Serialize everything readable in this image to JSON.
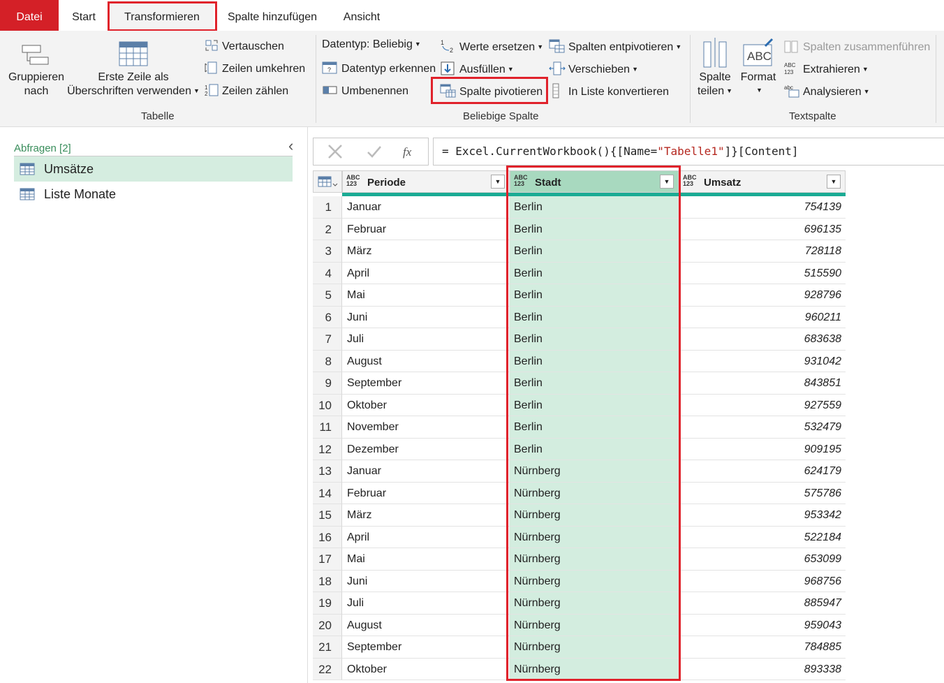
{
  "tabs": {
    "datei": "Datei",
    "start": "Start",
    "transformieren": "Transformieren",
    "spalte_hinzufuegen": "Spalte hinzufügen",
    "ansicht": "Ansicht"
  },
  "ribbon": {
    "tabelle": {
      "gruppieren_l1": "Gruppieren",
      "gruppieren_l2": "nach",
      "erste_zeile_l1": "Erste Zeile als",
      "erste_zeile_l2": "Überschriften verwenden",
      "vertauschen": "Vertauschen",
      "zeilen_umkehren": "Zeilen umkehren",
      "zeilen_zaehlen": "Zeilen zählen",
      "group_label": "Tabelle"
    },
    "beliebige_spalte": {
      "datentyp": "Datentyp: Beliebig",
      "datentyp_erkennen": "Datentyp erkennen",
      "umbenennen": "Umbenennen",
      "werte_ersetzen": "Werte ersetzen",
      "ausfuellen": "Ausfüllen",
      "spalte_pivotieren": "Spalte pivotieren",
      "spalten_entpivotieren": "Spalten entpivotieren",
      "verschieben": "Verschieben",
      "in_liste": "In Liste konvertieren",
      "group_label": "Beliebige Spalte"
    },
    "textspalte": {
      "spalte_teilen_l1": "Spalte",
      "spalte_teilen_l2": "teilen",
      "format": "Format",
      "zusammenfuehren": "Spalten zusammenführen",
      "extrahieren": "Extrahieren",
      "analysieren": "Analysieren",
      "group_label": "Textspalte"
    }
  },
  "queries": {
    "header": "Abfragen [2]",
    "items": [
      "Umsätze",
      "Liste Monate"
    ]
  },
  "formula": {
    "prefix": "= Excel.CurrentWorkbook(){[Name=",
    "string": "\"Tabelle1\"",
    "suffix": "]}[Content]"
  },
  "grid": {
    "columns": [
      "Periode",
      "Stadt",
      "Umsatz"
    ],
    "type_badge_top": "ABC",
    "type_badge_bottom": "123",
    "rows": [
      [
        "1",
        "Januar",
        "Berlin",
        "754139"
      ],
      [
        "2",
        "Februar",
        "Berlin",
        "696135"
      ],
      [
        "3",
        "März",
        "Berlin",
        "728118"
      ],
      [
        "4",
        "April",
        "Berlin",
        "515590"
      ],
      [
        "5",
        "Mai",
        "Berlin",
        "928796"
      ],
      [
        "6",
        "Juni",
        "Berlin",
        "960211"
      ],
      [
        "7",
        "Juli",
        "Berlin",
        "683638"
      ],
      [
        "8",
        "August",
        "Berlin",
        "931042"
      ],
      [
        "9",
        "September",
        "Berlin",
        "843851"
      ],
      [
        "10",
        "Oktober",
        "Berlin",
        "927559"
      ],
      [
        "11",
        "November",
        "Berlin",
        "532479"
      ],
      [
        "12",
        "Dezember",
        "Berlin",
        "909195"
      ],
      [
        "13",
        "Januar",
        "Nürnberg",
        "624179"
      ],
      [
        "14",
        "Februar",
        "Nürnberg",
        "575786"
      ],
      [
        "15",
        "März",
        "Nürnberg",
        "953342"
      ],
      [
        "16",
        "April",
        "Nürnberg",
        "522184"
      ],
      [
        "17",
        "Mai",
        "Nürnberg",
        "653099"
      ],
      [
        "18",
        "Juni",
        "Nürnberg",
        "968756"
      ],
      [
        "19",
        "Juli",
        "Nürnberg",
        "885947"
      ],
      [
        "20",
        "August",
        "Nürnberg",
        "959043"
      ],
      [
        "21",
        "September",
        "Nürnberg",
        "784885"
      ],
      [
        "22",
        "Oktober",
        "Nürnberg",
        "893338"
      ]
    ]
  },
  "colors": {
    "accent_red": "#d42027",
    "highlight_box": "#e0222b",
    "selected_column": "#d3eddf",
    "teal_bar": "#1aab94"
  }
}
